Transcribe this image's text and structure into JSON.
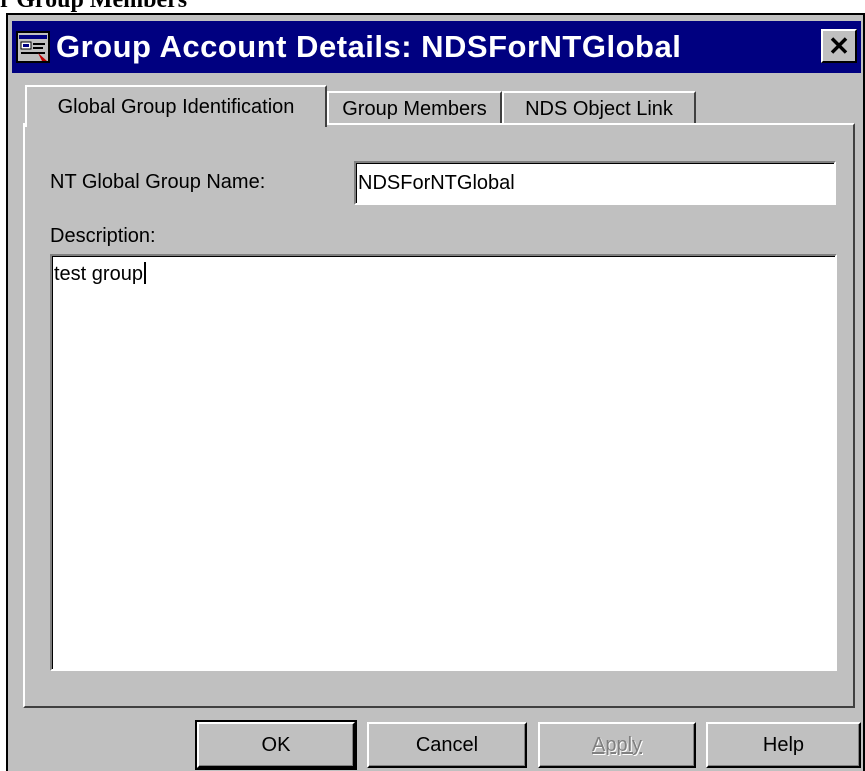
{
  "page_caption": "r Group Members",
  "window": {
    "title": "Group Account Details:  NDSForNTGlobal",
    "close_glyph": "✕"
  },
  "tabs": [
    {
      "label": "Global Group Identification",
      "active": true
    },
    {
      "label": "Group Members",
      "active": false
    },
    {
      "label": "NDS Object Link",
      "active": false
    }
  ],
  "form": {
    "group_name_label": "NT Global Group Name:",
    "group_name_value": "NDSForNTGlobal",
    "description_label": "Description:",
    "description_value": "test group"
  },
  "buttons": {
    "ok": "OK",
    "cancel": "Cancel",
    "apply": "Apply",
    "help": "Help"
  },
  "colors": {
    "titlebar": "#000080",
    "face": "#c0c0c0"
  }
}
